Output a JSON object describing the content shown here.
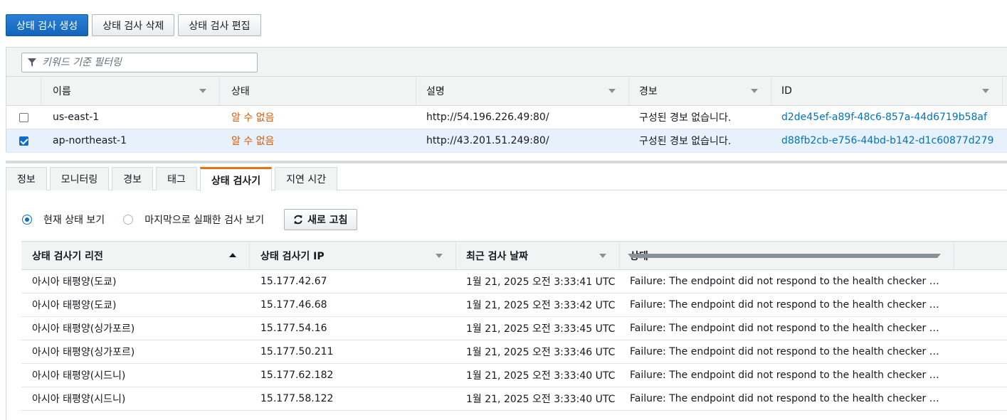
{
  "toolbar": {
    "create_label": "상태 검사 생성",
    "delete_label": "상태 검사 삭제",
    "edit_label": "상태 검사 편집"
  },
  "filter": {
    "placeholder": "키워드 기준 필터링"
  },
  "table": {
    "columns": [
      "이름",
      "상태",
      "설명",
      "경보",
      "ID"
    ],
    "rows": [
      {
        "checked": false,
        "name": "us-east-1",
        "status": "알 수 없음",
        "description": "http://54.196.226.49:80/",
        "alarm": "구성된 경보 없습니다.",
        "id": "d2de45ef-a89f-48c6-857a-44d6719b58af"
      },
      {
        "checked": true,
        "name": "ap-northeast-1",
        "status": "알 수 없음",
        "description": "http://43.201.51.249:80/",
        "alarm": "구성된 경보 없습니다.",
        "id": "d88fb2cb-e756-44bd-b142-d1c60877d279"
      }
    ]
  },
  "tabs": [
    {
      "label": "정보",
      "active": false
    },
    {
      "label": "모니터링",
      "active": false
    },
    {
      "label": "경보",
      "active": false
    },
    {
      "label": "태그",
      "active": false
    },
    {
      "label": "상태 검사기",
      "active": true
    },
    {
      "label": "지연 시간",
      "active": false
    }
  ],
  "view_options": {
    "current_label": "현재 상태 보기",
    "last_failed_label": "마지막으로 실패한 검사 보기",
    "selected": "current",
    "refresh_label": "새로 고침"
  },
  "checkers": {
    "columns": [
      "상태 검사기 리전",
      "상태 검사기 IP",
      "최근 검사 날짜",
      "상태"
    ],
    "rows": [
      {
        "region": "아시아 태평양(도쿄)",
        "ip": "15.177.42.67",
        "date": "1월 21, 2025 오전 3:33:41 UTC",
        "status": "Failure: The endpoint did not respond to the health checker request within the timeout limit"
      },
      {
        "region": "아시아 태평양(도쿄)",
        "ip": "15.177.46.68",
        "date": "1월 21, 2025 오전 3:33:42 UTC",
        "status": "Failure: The endpoint did not respond to the health checker request within the timeout limit"
      },
      {
        "region": "아시아 태평양(싱가포르)",
        "ip": "15.177.54.16",
        "date": "1월 21, 2025 오전 3:33:45 UTC",
        "status": "Failure: The endpoint did not respond to the health checker request within the timeout limit"
      },
      {
        "region": "아시아 태평양(싱가포르)",
        "ip": "15.177.50.211",
        "date": "1월 21, 2025 오전 3:33:46 UTC",
        "status": "Failure: The endpoint did not respond to the health checker request within the timeout limit"
      },
      {
        "region": "아시아 태평양(시드니)",
        "ip": "15.177.62.182",
        "date": "1월 21, 2025 오전 3:33:40 UTC",
        "status": "Failure: The endpoint did not respond to the health checker request within the timeout limit"
      },
      {
        "region": "아시아 태평양(시드니)",
        "ip": "15.177.58.122",
        "date": "1월 21, 2025 오전 3:33:40 UTC",
        "status": "Failure: The endpoint did not respond to the health checker request within the timeout limit"
      }
    ]
  },
  "colors": {
    "primary": "#1166bb",
    "status_unknown": "#d45b07",
    "link": "#0073bb",
    "tab_accent": "#ec7211"
  }
}
